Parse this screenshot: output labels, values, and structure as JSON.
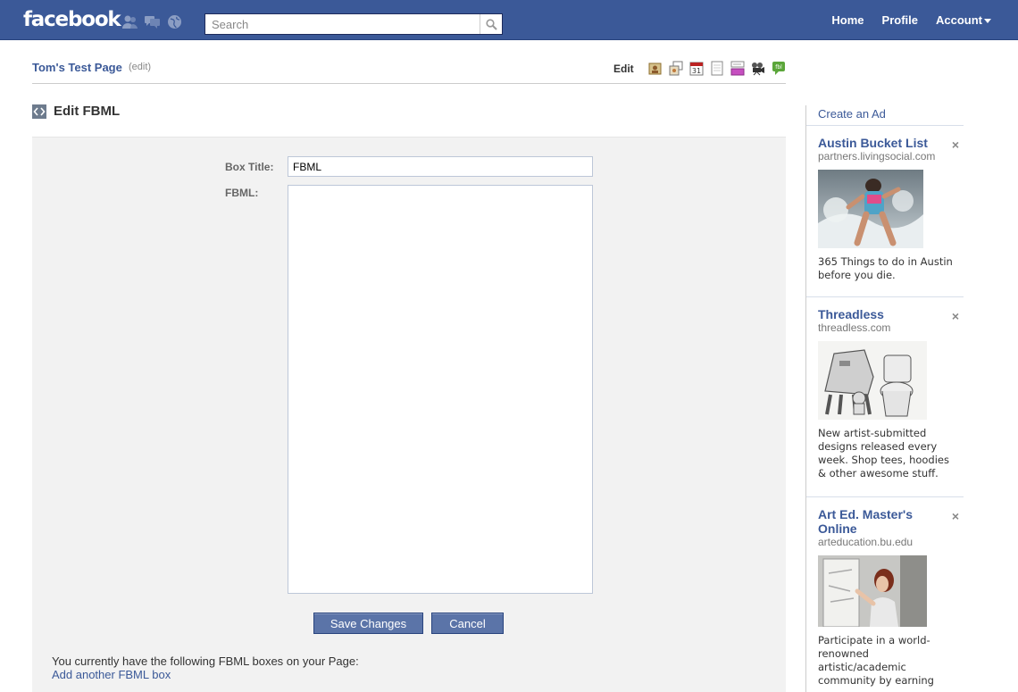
{
  "header": {
    "logo": "facebook",
    "search_placeholder": "Search",
    "nav": {
      "home": "Home",
      "profile": "Profile",
      "account": "Account"
    }
  },
  "page": {
    "name": "Tom's Test Page",
    "edit_link": "(edit)",
    "edit_label": "Edit",
    "app_icons": [
      "profile-app-icon",
      "photos-app-icon",
      "events-app-icon",
      "notes-app-icon",
      "discussions-app-icon",
      "video-app-icon",
      "fbml-app-icon"
    ]
  },
  "section": {
    "title": "Edit FBML"
  },
  "form": {
    "box_title_label": "Box Title:",
    "box_title_value": "FBML",
    "fbml_label": "FBML:",
    "fbml_value": "",
    "save_label": "Save Changes",
    "cancel_label": "Cancel",
    "current_boxes_text": "You currently have the following FBML boxes on your Page:",
    "add_box_link": "Add another FBML box"
  },
  "ads": {
    "create_label": "Create an Ad",
    "close_symbol": "×",
    "items": [
      {
        "title": "Austin Bucket List",
        "url": "partners.livingsocial.com",
        "text": "365 Things to do in Austin before you die."
      },
      {
        "title": "Threadless",
        "url": "threadless.com",
        "text": "New artist-submitted designs released every week. Shop tees, hoodies & other awesome stuff."
      },
      {
        "title": "Art Ed. Master's Online",
        "url": "arteducation.bu.edu",
        "text": "Participate in a world-renowned artistic/academic community by earning"
      }
    ]
  },
  "colors": {
    "brand": "#3b5998",
    "panel": "#f2f2f2",
    "button": "#5b74a8"
  }
}
